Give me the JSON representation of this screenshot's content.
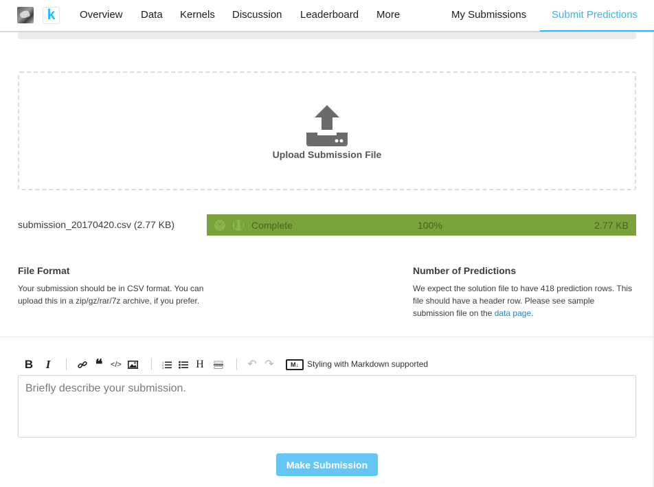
{
  "nav": {
    "items": [
      "Overview",
      "Data",
      "Kernels",
      "Discussion",
      "Leaderboard",
      "More"
    ],
    "my_submissions": "My Submissions",
    "submit_predictions": "Submit Predictions",
    "logo_letter": "k",
    "icons": {
      "competition": "competition-thumbnail-icon",
      "brand": "kaggle-logo-icon"
    }
  },
  "upload": {
    "label": "Upload Submission File",
    "icon": "upload-tray-icon"
  },
  "file": {
    "name": "submission_20170420.csv (2.77 KB)",
    "status": "Complete",
    "percent": "100%",
    "progress": 1.0,
    "size": "2.77 KB"
  },
  "file_format": {
    "title": "File Format",
    "text": "Your submission should be in CSV format. You can upload this in a zip/gz/rar/7z archive, if you prefer."
  },
  "predictions": {
    "title": "Number of Predictions",
    "text_before": "We expect the solution file to have 418 prediction rows. This file should have a header row. Please see sample submission file on the ",
    "link": "data page",
    "text_after": "."
  },
  "editor": {
    "bold": "B",
    "italic": "I",
    "heading": "H",
    "markdown_badge": "M↓",
    "markdown_text": "Styling with Markdown supported",
    "placeholder": "Briefly describe your submission."
  },
  "submit_label": "Make Submission",
  "colors": {
    "accent": "#20beff",
    "progress_bg": "#79a33a",
    "button_bg": "#66c6f3",
    "link": "#1a87c9"
  }
}
